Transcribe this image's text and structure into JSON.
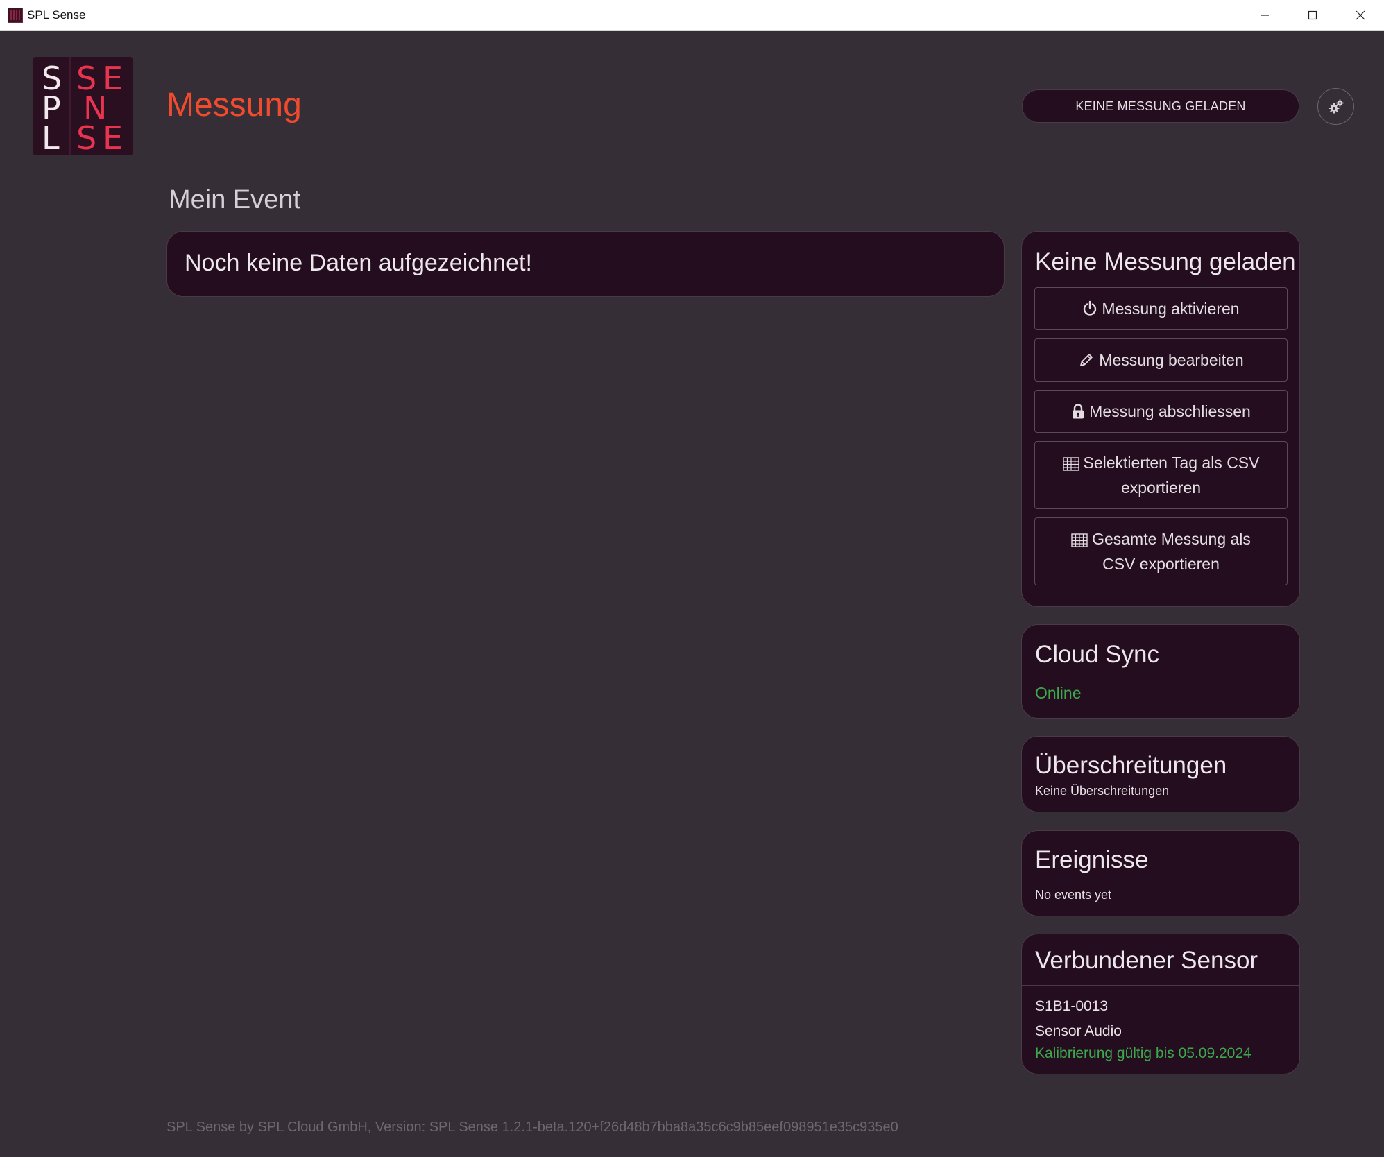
{
  "window": {
    "title": "SPL Sense",
    "minimize_icon": "minimize-icon",
    "maximize_icon": "maximize-icon",
    "close_icon": "close-icon"
  },
  "logo": {
    "letters": [
      "S",
      "P",
      "L",
      "S",
      "E",
      "N",
      "S",
      "E"
    ]
  },
  "header": {
    "title": "Messung",
    "status_pill": "KEINE MESSUNG GELADEN",
    "settings_icon": "gears-icon"
  },
  "event": {
    "name": "Mein Event",
    "no_data": "Noch keine Daten aufgezeichnet!"
  },
  "measurement_panel": {
    "title": "Keine Messung geladen",
    "actions": [
      {
        "label": "Messung aktivieren",
        "icon": "power-icon"
      },
      {
        "label": "Messung bearbeiten",
        "icon": "pencil-icon"
      },
      {
        "label": "Messung abschliessen",
        "icon": "lock-icon"
      },
      {
        "label_line1": "Selektierten Tag als CSV",
        "label_line2": "exportieren",
        "icon": "table-icon"
      },
      {
        "label_line1": "Gesamte Messung als",
        "label_line2": "CSV exportieren",
        "icon": "table-icon"
      }
    ]
  },
  "cloud_sync": {
    "title": "Cloud Sync",
    "status": "Online"
  },
  "exceedances": {
    "title": "Überschreitungen",
    "text": "Keine Überschreitungen"
  },
  "events": {
    "title": "Ereignisse",
    "text": "No events yet"
  },
  "sensor": {
    "title": "Verbundener Sensor",
    "id": "S1B1-0013",
    "type": "Sensor Audio",
    "calibration": "Kalibrierung gültig bis 05.09.2024"
  },
  "footer": {
    "text": "SPL Sense by SPL Cloud GmbH, Version: SPL Sense 1.2.1-beta.120+f26d48b7bba8a35c6c9b85eef098951e35c935e0"
  },
  "colors": {
    "background": "#352e36",
    "card": "#230d1e",
    "accent": "#ef4b2e",
    "success": "#3ca94b",
    "logo_red": "#e8344f"
  }
}
